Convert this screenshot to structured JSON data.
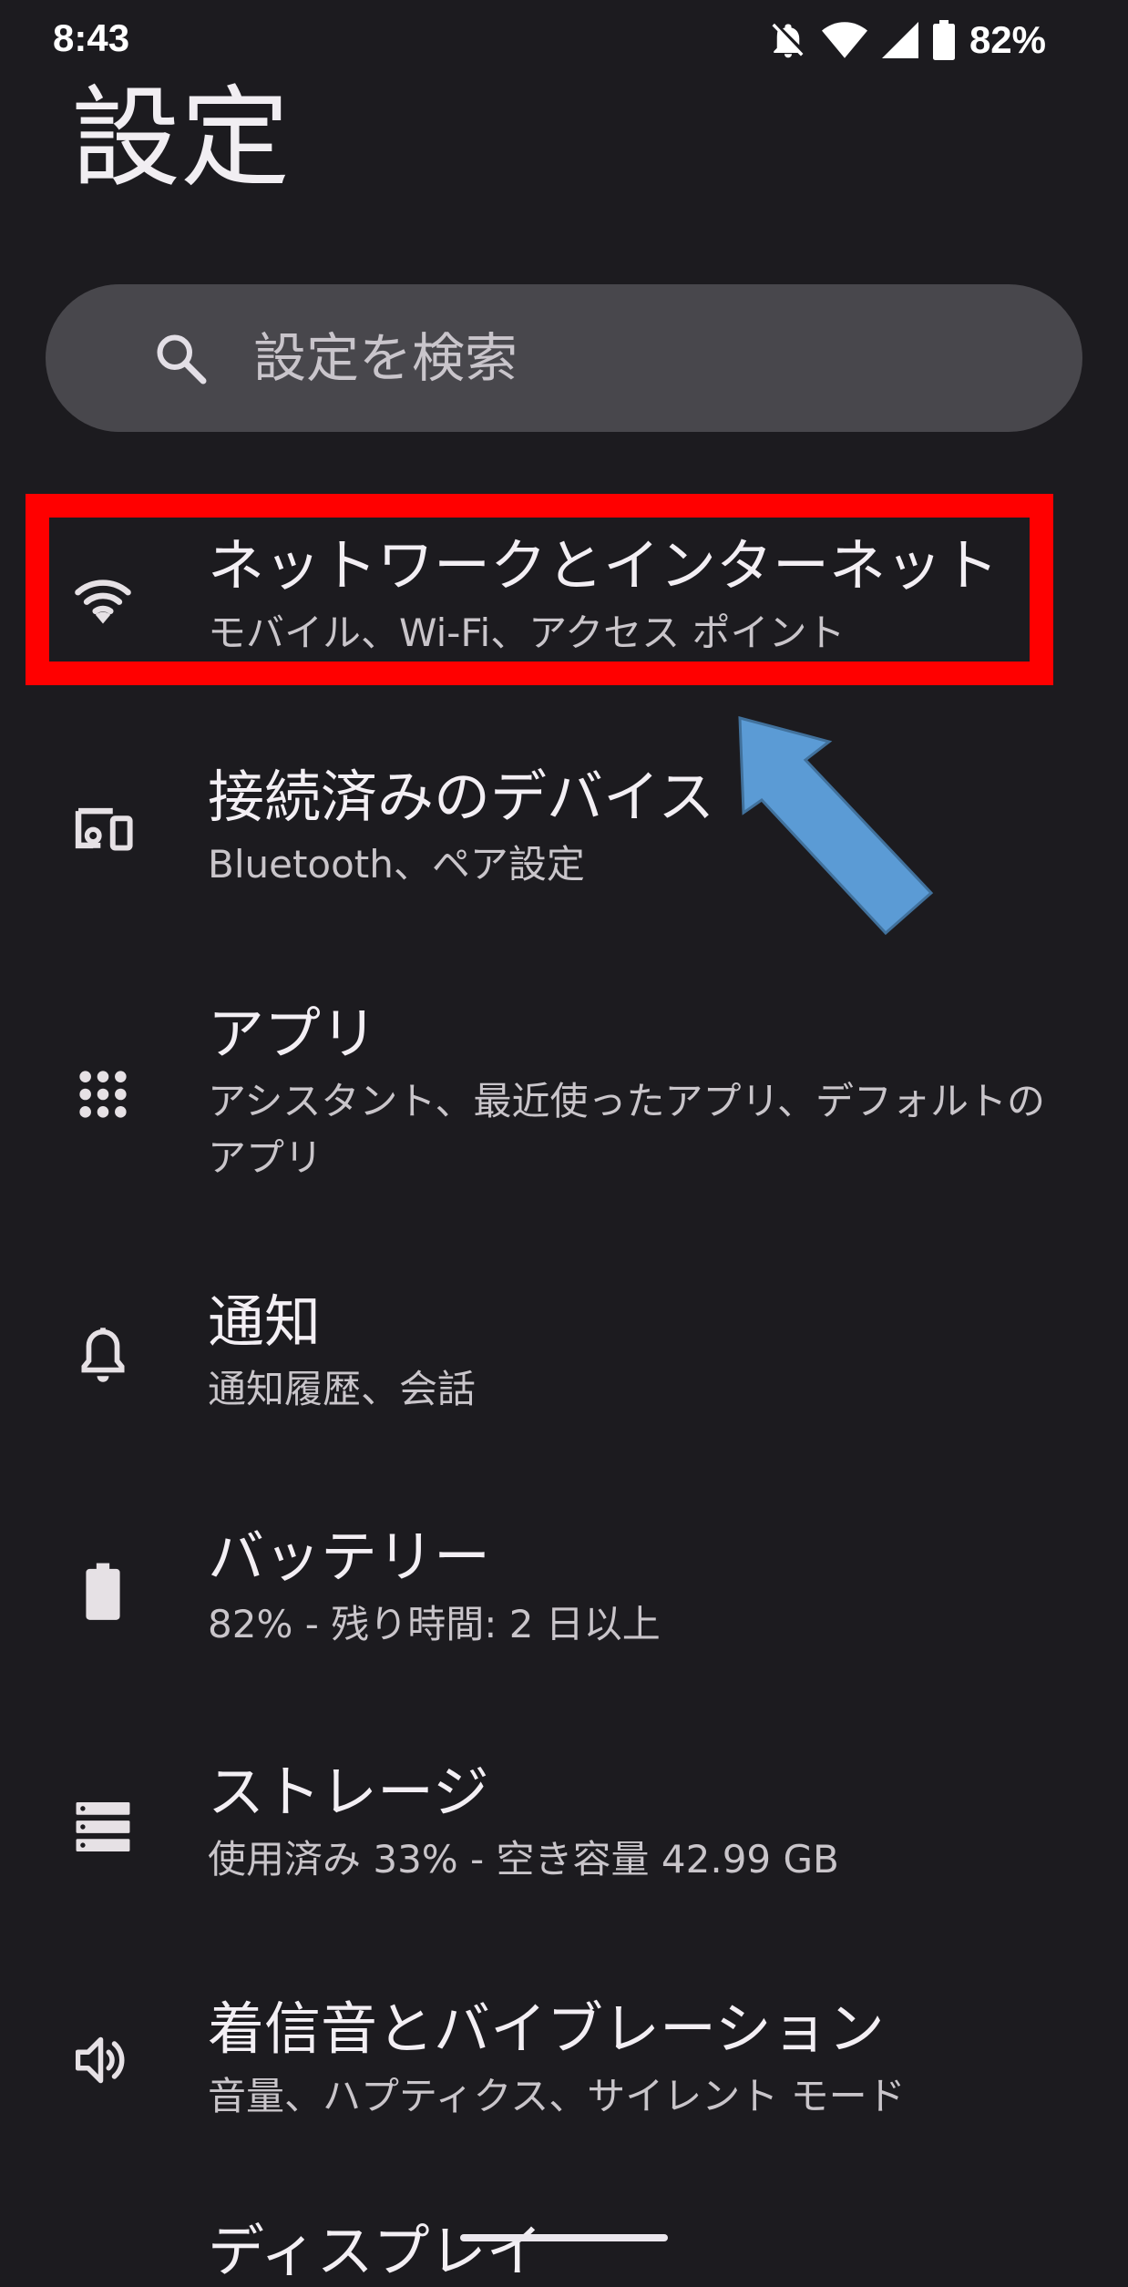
{
  "status_bar": {
    "time": "8:43",
    "battery_percent": "82%",
    "icons": [
      "notifications-off-icon",
      "wifi-icon",
      "signal-icon",
      "battery-icon"
    ]
  },
  "page": {
    "title": "設定"
  },
  "search": {
    "placeholder": "設定を検索",
    "icon": "search-icon"
  },
  "settings": [
    {
      "id": "network",
      "icon": "wifi-icon",
      "label": "ネットワークとインターネット",
      "summary": "モバイル、Wi-Fi、アクセス ポイント"
    },
    {
      "id": "devices",
      "icon": "connected-devices-icon",
      "label": "接続済みのデバイス",
      "summary": "Bluetooth、ペア設定"
    },
    {
      "id": "apps",
      "icon": "apps-grid-icon",
      "label": "アプリ",
      "summary": "アシスタント、最近使ったアプリ、デフォルトのアプリ"
    },
    {
      "id": "notifications",
      "icon": "bell-icon",
      "label": "通知",
      "summary": "通知履歴、会話"
    },
    {
      "id": "battery",
      "icon": "battery-icon",
      "label": "バッテリー",
      "summary": "82% - 残り時間: 2 日以上"
    },
    {
      "id": "storage",
      "icon": "storage-icon",
      "label": "ストレージ",
      "summary": "使用済み 33% - 空き容量 42.99 GB"
    },
    {
      "id": "sound",
      "icon": "volume-icon",
      "label": "着信音とバイブレーション",
      "summary": "音量、ハプティクス、サイレント モード"
    }
  ],
  "partially_visible_item": {
    "label": "ディスプレイ"
  },
  "annotation": {
    "highlight_color": "#ff0000",
    "arrow_color": "#5b9bd5"
  },
  "colors": {
    "background": "#1c1b1f",
    "search_bar": "#48474c"
  }
}
